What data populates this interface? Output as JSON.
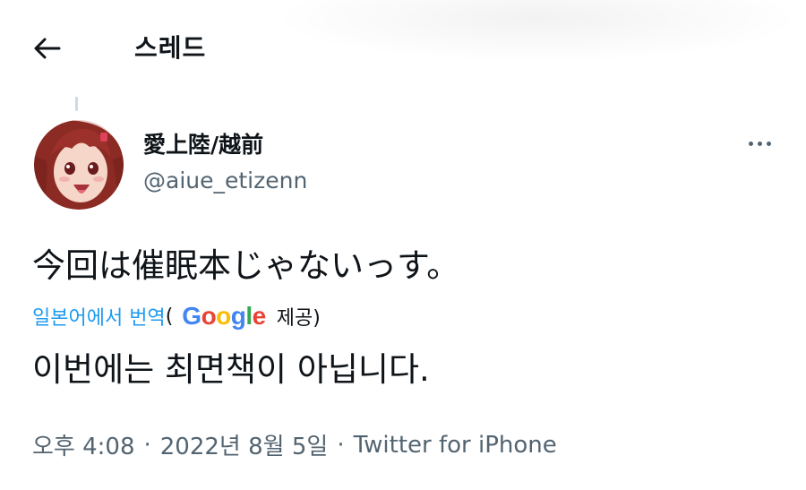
{
  "header": {
    "title": "스레드",
    "back_icon": "arrow-left-icon"
  },
  "tweet": {
    "author": {
      "display_name": "愛上陸/越前",
      "handle": "@aiue_etizenn",
      "avatar": "anime-avatar"
    },
    "more_icon": "more-horizontal-icon",
    "text": "今回は催眠本じゃないっす。",
    "translation": {
      "link_label": "일본어에서 번역",
      "open_paren": "(",
      "provider_logo": "Google",
      "provided_by": "제공)",
      "text": "이번에는 최면책이 아닙니다."
    },
    "meta": {
      "time": "오후 4:08",
      "separator": "·",
      "date": "2022년 8월 5일",
      "source": "Twitter for iPhone"
    }
  },
  "colors": {
    "accent": "#1d9bf0",
    "text_primary": "#0f1419",
    "text_secondary": "#536471"
  }
}
